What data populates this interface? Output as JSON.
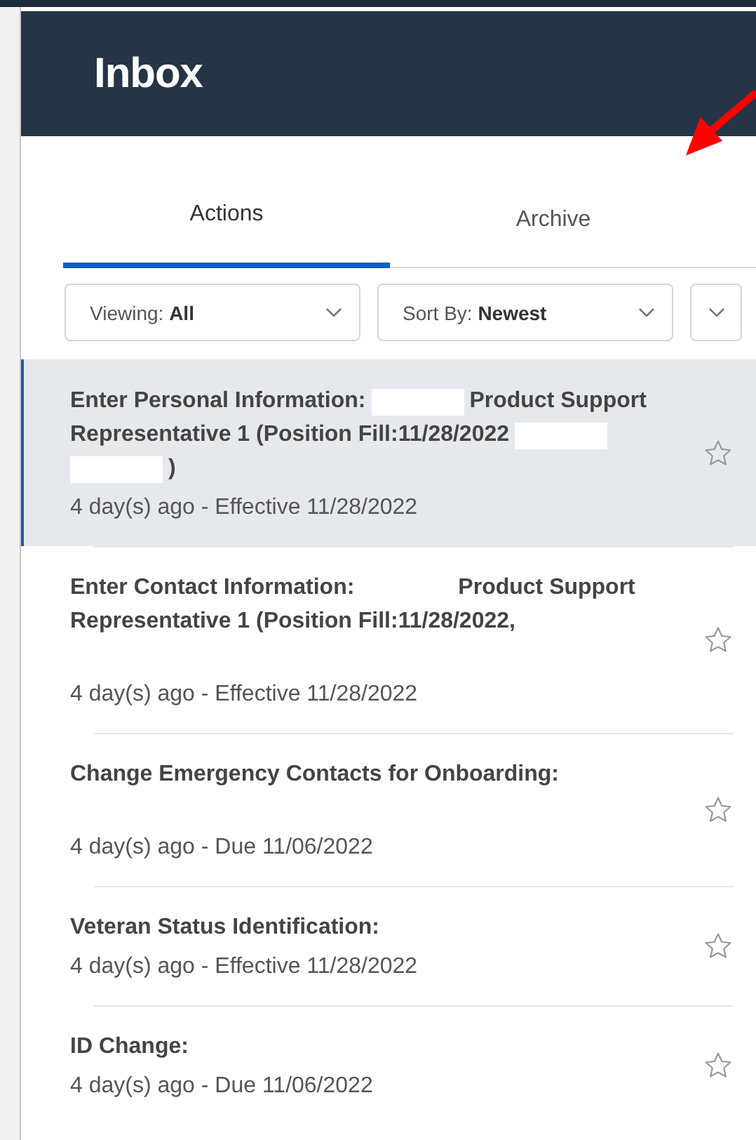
{
  "header": {
    "title": "Inbox"
  },
  "annotation": {
    "kind": "arrow",
    "color": "#ff0000"
  },
  "tabs": [
    {
      "label": "Actions",
      "selected": true
    },
    {
      "label": "Archive",
      "selected": false
    }
  ],
  "filters": [
    {
      "label": "Viewing:",
      "value": "All"
    },
    {
      "label": "Sort By:",
      "value": "Newest"
    }
  ],
  "items": [
    {
      "selected": true,
      "starred": false,
      "title_lines": [
        [
          {
            "kind": "text",
            "text": "Enter Personal Information:"
          },
          {
            "kind": "redaction"
          },
          {
            "kind": "text",
            "text": "Product Support"
          }
        ],
        [
          {
            "kind": "text",
            "text": "Representative 1 (Position Fill:11/28/2022"
          },
          {
            "kind": "redaction"
          }
        ],
        [
          {
            "kind": "redaction"
          },
          {
            "kind": "text",
            "text": ")"
          }
        ]
      ],
      "meta": "4 day(s) ago - Effective 11/28/2022"
    },
    {
      "selected": false,
      "starred": false,
      "title_lines": [
        [
          {
            "kind": "text",
            "text": "Enter Contact Information:"
          },
          {
            "kind": "redaction"
          },
          {
            "kind": "text",
            "text": "Product Support"
          }
        ],
        [
          {
            "kind": "text",
            "text": "Representative 1 (Position Fill:11/28/2022,"
          }
        ],
        [
          {
            "kind": "redaction"
          }
        ]
      ],
      "meta": "4 day(s) ago - Effective 11/28/2022"
    },
    {
      "selected": false,
      "starred": false,
      "title_lines": [
        [
          {
            "kind": "text",
            "text": "Change Emergency Contacts for Onboarding:"
          }
        ],
        [
          {
            "kind": "redaction"
          }
        ]
      ],
      "meta": "4 day(s) ago - Due 11/06/2022"
    },
    {
      "selected": false,
      "starred": false,
      "title_lines": [
        [
          {
            "kind": "text",
            "text": "Veteran Status Identification:"
          }
        ]
      ],
      "meta": "4 day(s) ago - Effective 11/28/2022"
    },
    {
      "selected": false,
      "starred": false,
      "title_lines": [
        [
          {
            "kind": "text",
            "text": "ID Change:"
          }
        ]
      ],
      "meta": "4 day(s) ago - Due 11/06/2022"
    }
  ]
}
